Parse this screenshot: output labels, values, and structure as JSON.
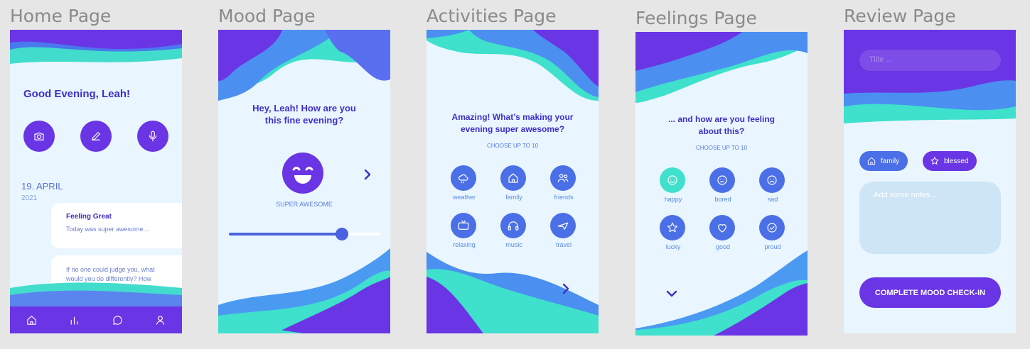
{
  "panels": {
    "home": "Home Page",
    "mood": "Mood Page",
    "activities": "Activities Page",
    "feelings": "Feelings Page",
    "review": "Review Page"
  },
  "home": {
    "greeting": "Good Evening, Leah!",
    "date_day": "19. APRIL",
    "date_year": "2021",
    "cards": [
      {
        "title": "Feeling Great",
        "text": "Today was super awesome..."
      },
      {
        "text_line1": "If no one could judge you, what",
        "text_line2": "would you do differently? How"
      }
    ],
    "action_icons": [
      "camera-icon",
      "pencil-icon",
      "microphone-icon"
    ],
    "nav_icons": [
      "home-icon",
      "chart-icon",
      "chat-icon",
      "profile-icon"
    ]
  },
  "mood": {
    "question_line1": "Hey, Leah! How are you",
    "question_line2": "this fine evening?",
    "mood_label": "SUPER AWESOME",
    "slider_value": 0.75
  },
  "activities": {
    "question_line1": "Amazing! What’s making your",
    "question_line2": "evening super awesome?",
    "hint": "CHOOSE UP TO 10",
    "items": [
      {
        "label": "weather",
        "icon": "cloud-icon"
      },
      {
        "label": "family",
        "icon": "house-icon"
      },
      {
        "label": "friends",
        "icon": "people-icon"
      },
      {
        "label": "relaxing",
        "icon": "tv-icon"
      },
      {
        "label": "music",
        "icon": "headphones-icon"
      },
      {
        "label": "travel",
        "icon": "plane-icon"
      }
    ]
  },
  "feelings": {
    "question_line1": "... and how are you feeling",
    "question_line2": "about this?",
    "hint": "CHOOSE UP TO 10",
    "items": [
      {
        "label": "happy",
        "icon": "happy-face-icon",
        "selected": true
      },
      {
        "label": "bored",
        "icon": "neutral-face-icon"
      },
      {
        "label": "sad",
        "icon": "sad-face-icon"
      },
      {
        "label": "lucky",
        "icon": "star-icon"
      },
      {
        "label": "good",
        "icon": "heart-icon"
      },
      {
        "label": "proud",
        "icon": "check-circle-icon"
      }
    ]
  },
  "review": {
    "title_placeholder": "Title ...",
    "chips": [
      {
        "label": "family",
        "icon": "house-icon"
      },
      {
        "label": "blessed",
        "icon": "star-icon"
      }
    ],
    "notes_placeholder": "Add some notes...",
    "complete_button": "COMPLETE MOOD CHECK-IN"
  },
  "colors": {
    "primary": "#6a35e4",
    "blue": "#4b6fe7",
    "teal": "#3fe0cc",
    "text": "#3f2fc8",
    "screen_bg": "#e9f6ff"
  }
}
